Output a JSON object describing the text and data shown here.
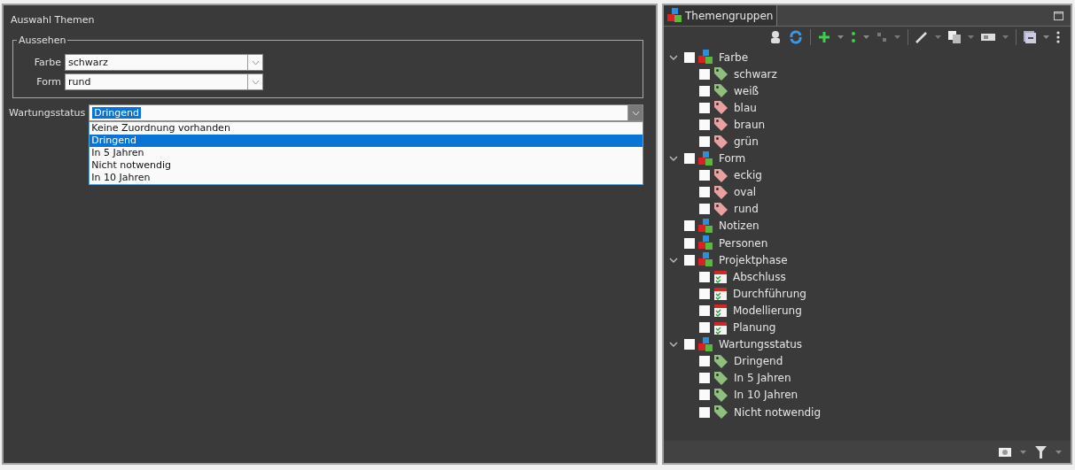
{
  "left_panel": {
    "title": "Auswahl Themen",
    "group": {
      "title": "Aussehen",
      "fields": [
        {
          "label": "Farbe",
          "value": "schwarz"
        },
        {
          "label": "Form",
          "value": "rund"
        }
      ]
    },
    "status_field": {
      "label": "Wartungsstatus",
      "value": "Dringend",
      "expanded": true,
      "options": [
        {
          "label": "Keine Zuordnung vorhanden",
          "selected": false
        },
        {
          "label": "Dringend",
          "selected": true
        },
        {
          "label": "In 5 Jahren",
          "selected": false
        },
        {
          "label": "Nicht notwendig",
          "selected": false
        },
        {
          "label": "In 10 Jahren",
          "selected": false
        }
      ]
    }
  },
  "right_panel": {
    "tab": {
      "label": "Themengruppen",
      "selected": true
    },
    "tree": [
      {
        "kind": "group",
        "label": "Farbe",
        "checked": false,
        "expanded": true,
        "children": [
          {
            "kind": "tag",
            "label": "schwarz",
            "checked": false,
            "color": "#8fbf7f"
          },
          {
            "kind": "tag",
            "label": "weiß",
            "checked": false,
            "color": "#8fbf7f"
          },
          {
            "kind": "tag",
            "label": "blau",
            "checked": false,
            "color": "#e8a0a0"
          },
          {
            "kind": "tag",
            "label": "braun",
            "checked": false,
            "color": "#e8a0a0"
          },
          {
            "kind": "tag",
            "label": "grün",
            "checked": false,
            "color": "#e8a0a0"
          }
        ]
      },
      {
        "kind": "group",
        "label": "Form",
        "checked": false,
        "expanded": true,
        "children": [
          {
            "kind": "tag",
            "label": "eckig",
            "checked": false,
            "color": "#e8a0a0"
          },
          {
            "kind": "tag",
            "label": "oval",
            "checked": false,
            "color": "#e8a0a0"
          },
          {
            "kind": "tag",
            "label": "rund",
            "checked": false,
            "color": "#e8a0a0"
          }
        ]
      },
      {
        "kind": "group",
        "label": "Notizen",
        "checked": false
      },
      {
        "kind": "group",
        "label": "Personen",
        "checked": false
      },
      {
        "kind": "group",
        "label": "Projektphase",
        "checked": false,
        "expanded": true,
        "children": [
          {
            "kind": "phase",
            "label": "Abschluss",
            "checked": false
          },
          {
            "kind": "phase",
            "label": "Durchführung",
            "checked": false
          },
          {
            "kind": "phase",
            "label": "Modellierung",
            "checked": false
          },
          {
            "kind": "phase",
            "label": "Planung",
            "checked": false
          }
        ]
      },
      {
        "kind": "group",
        "label": "Wartungsstatus",
        "checked": false,
        "expanded": true,
        "children": [
          {
            "kind": "tag",
            "label": "Dringend",
            "checked": false,
            "color": "#8fbf7f"
          },
          {
            "kind": "tag",
            "label": "In 5 Jahren",
            "checked": false,
            "color": "#8fbf7f"
          },
          {
            "kind": "tag",
            "label": "In 10 Jahren",
            "checked": false,
            "color": "#8fbf7f"
          },
          {
            "kind": "tag",
            "label": "Nicht notwendig",
            "checked": false,
            "color": "#8fbf7f"
          }
        ]
      }
    ]
  }
}
